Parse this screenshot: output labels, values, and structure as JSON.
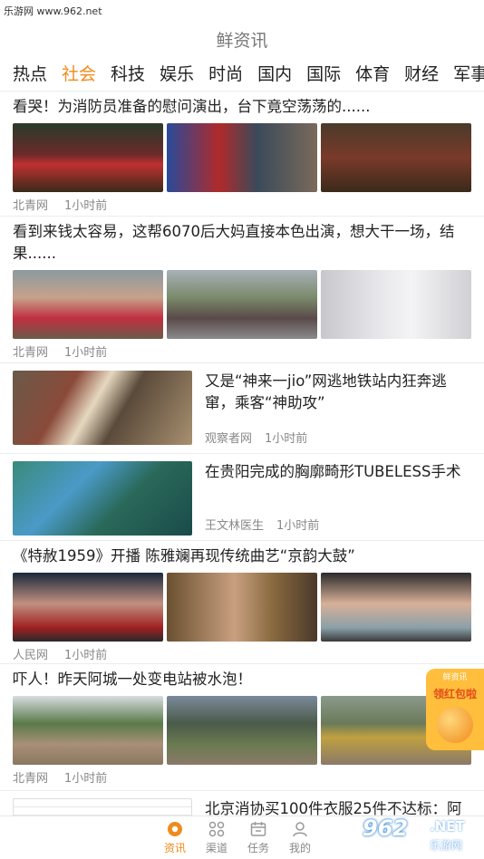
{
  "watermark_top": "乐游网 www.962.net",
  "app_title": "鲜资讯",
  "tabs": [
    "热点",
    "社会",
    "科技",
    "娱乐",
    "时尚",
    "国内",
    "国际",
    "体育",
    "财经",
    "军事"
  ],
  "active_tab": "社会",
  "feed": [
    {
      "title": "看哭！为消防员准备的慰问演出，台下竟空荡荡的......",
      "source": "北青网",
      "time": "1小时前"
    },
    {
      "title": "看到来钱太容易，这帮6070后大妈直接本色出演，想大干一场，结果......",
      "source": "北青网",
      "time": "1小时前"
    },
    {
      "title": "又是“神来一jio”网逃地铁站内狂奔逃窜，乘客“神助攻”",
      "source": "观察者网",
      "time": "1小时前"
    },
    {
      "title": "在贵阳完成的胸廓畸形TUBELESS手术",
      "source": "王文林医生",
      "time": "1小时前"
    },
    {
      "title": "《特赦1959》开播 陈雅斓再现传统曲艺“京韵大鼓”",
      "source": "人民网",
      "time": "1小时前"
    },
    {
      "title": "吓人！昨天阿城一处变电站被水泡！",
      "source": "北青网",
      "time": "1小时前"
    },
    {
      "title": "北京消协买100件衣服25件不达标：阿",
      "source": "",
      "time": ""
    }
  ],
  "float_badge": {
    "top": "鲜资讯",
    "main": "领红包啦"
  },
  "bottom_nav": [
    {
      "label": "资讯",
      "icon": "news-icon"
    },
    {
      "label": "渠道",
      "icon": "channel-grid-icon"
    },
    {
      "label": "任务",
      "icon": "task-calendar-icon"
    },
    {
      "label": "我的",
      "icon": "profile-icon"
    }
  ],
  "watermark_logo": {
    "num": "962",
    "net": ".NET",
    "sub": "乐游网"
  },
  "colors": {
    "accent": "#f08a1c"
  }
}
